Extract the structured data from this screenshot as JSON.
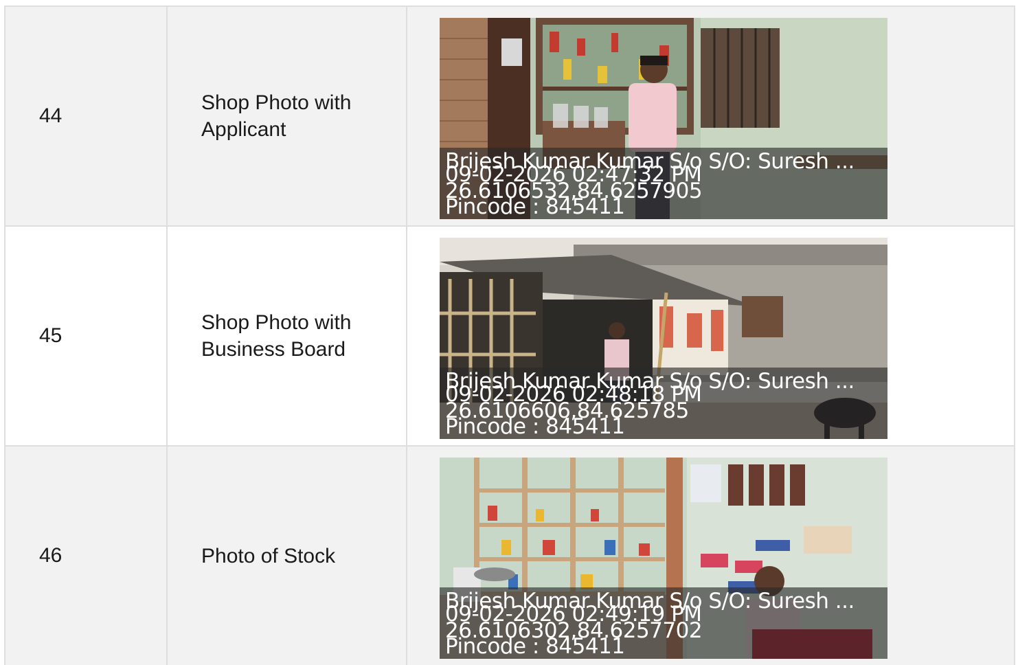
{
  "rows": [
    {
      "number": "44",
      "label": "Shop Photo with Applicant",
      "photo": {
        "subject": "shop-front-with-applicant",
        "caption_name": "Brijesh Kumar Kumar S/o S/O: Suresh ...",
        "caption_datetime": "09-02-2026 02:47:32 PM",
        "caption_coords": "26.6106532,84.6257905",
        "caption_pincode": "Pincode : 845411"
      }
    },
    {
      "number": "45",
      "label": "Shop Photo with Business Board",
      "photo": {
        "subject": "shop-exterior-with-tin-roof",
        "caption_name": "Brijesh Kumar Kumar S/o S/O: Suresh ...",
        "caption_datetime": "09-02-2026 02:48:18 PM",
        "caption_coords": "26.6106606,84.625785",
        "caption_pincode": "Pincode : 845411"
      }
    },
    {
      "number": "46",
      "label": "Photo of Stock",
      "photo": {
        "subject": "shop-interior-shelves-stock",
        "caption_name": "Brijesh Kumar Kumar S/o S/O: Suresh ...",
        "caption_datetime": "09-02-2026 02:49:19 PM",
        "caption_coords": "26.6106302,84.6257702",
        "caption_pincode": "Pincode : 845411"
      }
    }
  ],
  "colors": {
    "row_shade": "#f2f2f2",
    "row_plain": "#ffffff",
    "border": "#dedede",
    "text": "#1a1a1a",
    "caption_overlay": "rgba(40,40,40,0.62)"
  }
}
